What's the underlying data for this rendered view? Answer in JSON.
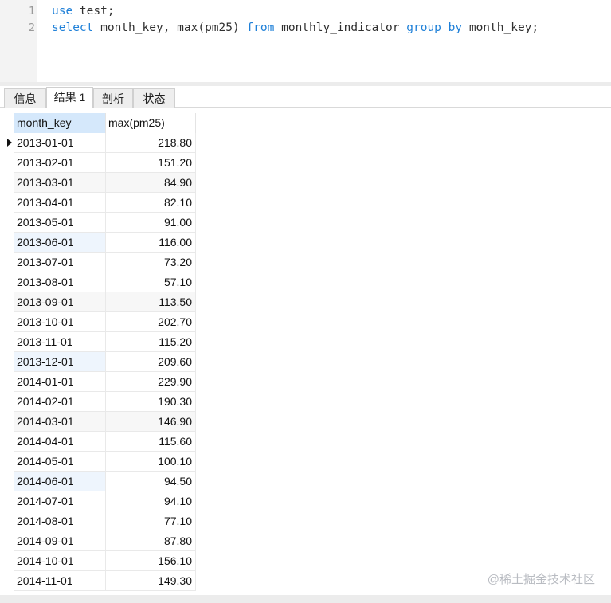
{
  "editor": {
    "lines": [
      {
        "number": "1",
        "kw1": "use",
        "text1": " test;"
      },
      {
        "number": "2",
        "kw1": "select",
        "text1": " month_key, max(pm25) ",
        "kw2": "from",
        "text2": " monthly_indicator ",
        "kw3": "group",
        "text3": " ",
        "kw4": "by",
        "text4": " month_key;"
      }
    ]
  },
  "tabs": [
    {
      "label": "信息",
      "active": false
    },
    {
      "label": "结果 1",
      "active": true
    },
    {
      "label": "剖析",
      "active": false
    },
    {
      "label": "状态",
      "active": false
    }
  ],
  "grid": {
    "columns": [
      "month_key",
      "max(pm25)"
    ],
    "rows": [
      [
        "2013-01-01",
        "218.80"
      ],
      [
        "2013-02-01",
        "151.20"
      ],
      [
        "2013-03-01",
        "84.90"
      ],
      [
        "2013-04-01",
        "82.10"
      ],
      [
        "2013-05-01",
        "91.00"
      ],
      [
        "2013-06-01",
        "116.00"
      ],
      [
        "2013-07-01",
        "73.20"
      ],
      [
        "2013-08-01",
        "57.10"
      ],
      [
        "2013-09-01",
        "113.50"
      ],
      [
        "2013-10-01",
        "202.70"
      ],
      [
        "2013-11-01",
        "115.20"
      ],
      [
        "2013-12-01",
        "209.60"
      ],
      [
        "2014-01-01",
        "229.90"
      ],
      [
        "2014-02-01",
        "190.30"
      ],
      [
        "2014-03-01",
        "146.90"
      ],
      [
        "2014-04-01",
        "115.60"
      ],
      [
        "2014-05-01",
        "100.10"
      ],
      [
        "2014-06-01",
        "94.50"
      ],
      [
        "2014-07-01",
        "94.10"
      ],
      [
        "2014-08-01",
        "77.10"
      ],
      [
        "2014-09-01",
        "87.80"
      ],
      [
        "2014-10-01",
        "156.10"
      ],
      [
        "2014-11-01",
        "149.30"
      ]
    ]
  },
  "watermark": "@稀土掘金技术社区"
}
